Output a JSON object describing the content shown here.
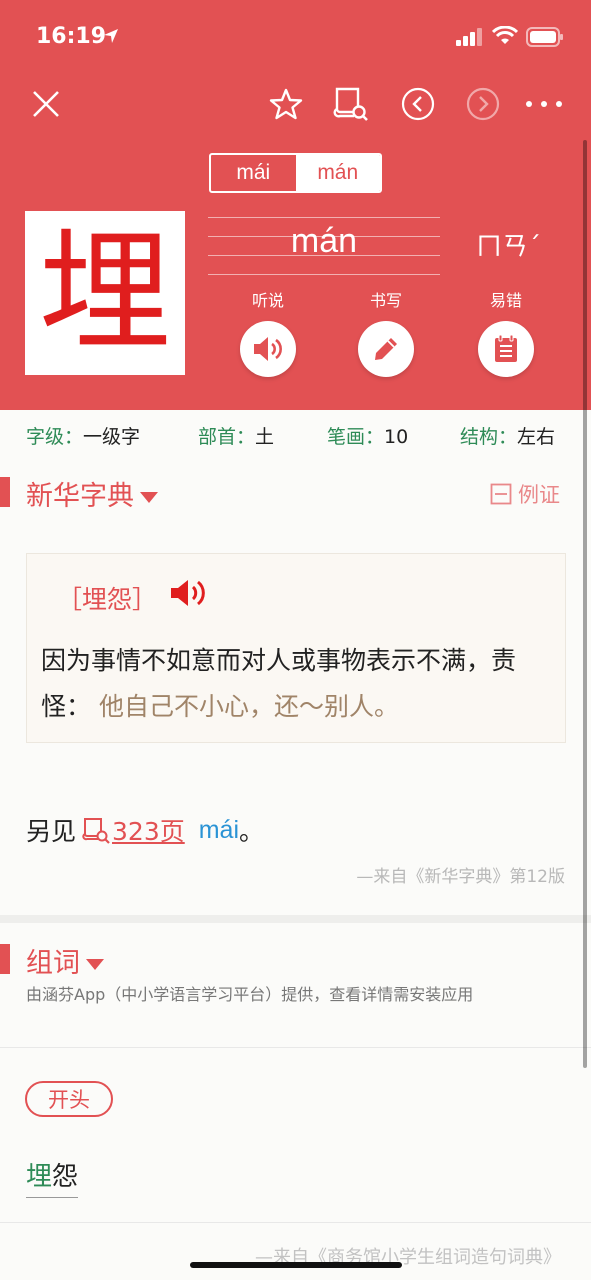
{
  "status": {
    "time": "16:19"
  },
  "toolbar": {
    "icons": [
      "close-icon",
      "star-icon",
      "book-search-icon",
      "prev-icon",
      "next-icon",
      "more-icon"
    ]
  },
  "pinyin_tabs": [
    {
      "label": "mái",
      "active": false
    },
    {
      "label": "mán",
      "active": true
    }
  ],
  "character": "埋",
  "pinyin": "mán",
  "zhuyin": "ㄇㄢˊ",
  "actions": [
    {
      "label": "听说",
      "icon": "speaker-icon"
    },
    {
      "label": "书写",
      "icon": "pencil-icon"
    },
    {
      "label": "易错",
      "icon": "notepad-icon"
    }
  ],
  "info": {
    "level_key": "字级：",
    "level_val": "一级字",
    "radical_key": "部首：",
    "radical_val": "土",
    "strokes_key": "笔画：",
    "strokes_val": "10",
    "structure_key": "结构：",
    "structure_val": "左右"
  },
  "xinhua": {
    "title": "新华字典",
    "example_toggle": "例证",
    "entry_word": "［埋怨］",
    "definition": "因为事情不如意而对人或事物表示不满，责怪：",
    "example": "他自己不小心，还～别人。",
    "see_also_prefix": "另见",
    "see_also_page": "323页",
    "see_also_pinyin": "mái",
    "see_also_suffix": "。",
    "source": "—来自《新华字典》第12版"
  },
  "zuci": {
    "title": "组词",
    "subtitle": "由涵芬App（中小学语言学习平台）提供，查看详情需安装应用",
    "filter": "开头",
    "word_hl": "埋",
    "word_rest": "怨",
    "source": "—来自《商务馆小学生组词造句词典》"
  },
  "colors": {
    "brand_red": "#e25153",
    "key_green": "#2e8b57",
    "link_blue": "#2a93d5"
  }
}
